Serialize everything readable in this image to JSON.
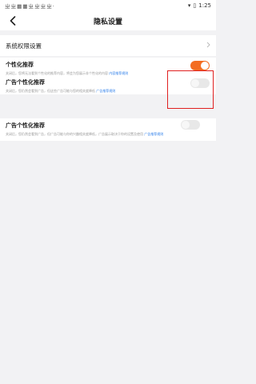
{
  "status_bar": {
    "left_icons": "ㄓ ㄓ ▦ ▦ ㄓ ㄓ ㄓ ㄓ ·",
    "time": "1:25"
  },
  "header": {
    "title": "隐私设置"
  },
  "system_row": {
    "label": "系统权限设置"
  },
  "personalized": {
    "title": "个性化推荐",
    "desc": "关闭后，您将无法看到个性化的推荐内容，将会为您展示非个性化的内容",
    "link": "内容推荐规则",
    "enabled": true
  },
  "ad_personalized": {
    "title": "广告个性化推荐",
    "desc": "关闭后，您仍然会看到广告，但这些广告可能与您的相关度降低",
    "link": "广告推荐规则",
    "enabled": false
  },
  "ad_personalized_2": {
    "title": "广告个性化推荐",
    "desc": "关闭后，您仍然会看到广告，但广告可能与你的兴趣相关度降低，广告展示取决于你的设置及使用",
    "link": "广告推荐规则",
    "enabled": false
  },
  "colors": {
    "accent": "#f36d21",
    "link": "#2b7de9",
    "highlight": "#e02020"
  }
}
